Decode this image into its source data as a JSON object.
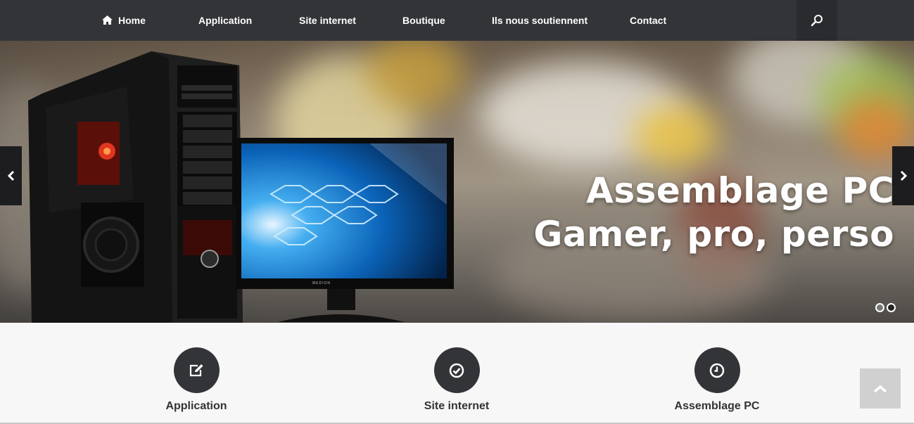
{
  "nav": {
    "items": [
      {
        "label": "Home",
        "icon": "home-icon"
      },
      {
        "label": "Application"
      },
      {
        "label": "Site internet"
      },
      {
        "label": "Boutique"
      },
      {
        "label": "Ils nous soutiennent"
      },
      {
        "label": "Contact"
      }
    ],
    "search_icon": "search-icon"
  },
  "hero": {
    "title_line1": "Assemblage PC",
    "title_line2": "Gamer, pro, perso",
    "monitor_brand": "MEDION",
    "slides": 2,
    "active_slide": 2
  },
  "features": [
    {
      "label": "Application",
      "icon": "edit-icon"
    },
    {
      "label": "Site internet",
      "icon": "check-circle-icon"
    },
    {
      "label": "Assemblage PC",
      "icon": "clock-icon"
    }
  ],
  "colors": {
    "nav_bg": "#333437",
    "circle_bg": "#333437",
    "page_bg": "#f7f7f7",
    "accent_red": "#d6231a"
  }
}
